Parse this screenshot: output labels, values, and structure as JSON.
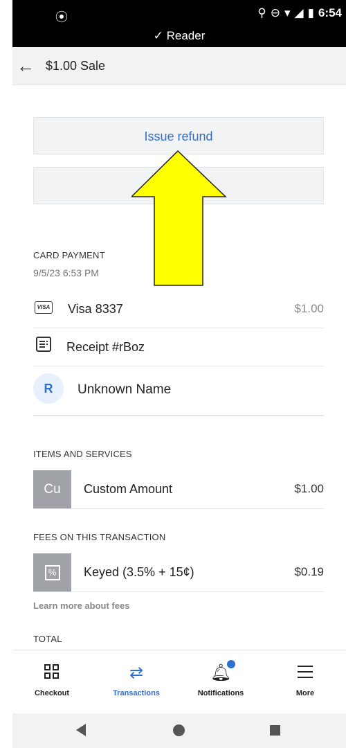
{
  "status_bar": {
    "left_icon": "screen-record-icon",
    "icons": [
      "location-icon",
      "do-not-disturb-icon",
      "wifi-icon",
      "signal-icon",
      "battery-icon"
    ],
    "time": "6:54",
    "reader_label": "✓ Reader"
  },
  "header": {
    "title": "$1.00 Sale"
  },
  "actions": {
    "refund_label": "Issue refund"
  },
  "card_payment": {
    "heading": "CARD PAYMENT",
    "datetime": "9/5/23 6:53 PM",
    "card_icon_text": "VISA",
    "card_label": "Visa 8337",
    "card_amount": "$1.00",
    "receipt_label": "Receipt #rBoz",
    "customer_icon": "R",
    "customer_name": "Unknown Name"
  },
  "items": {
    "heading": "ITEMS AND SERVICES",
    "tile_text": "Cu",
    "name": "Custom Amount",
    "amount": "$1.00"
  },
  "fees": {
    "heading": "FEES ON THIS TRANSACTION",
    "tile_text": "%",
    "name": "Keyed (3.5% + 15¢)",
    "amount": "$0.19",
    "learn_more": "Learn more about fees"
  },
  "total": {
    "heading": "TOTAL"
  },
  "bottom_nav": {
    "checkout": "Checkout",
    "transactions": "Transactions",
    "notifications": "Notifications",
    "more": "More",
    "active": "transactions",
    "accent_color": "#2f6fcf"
  },
  "annotation": {
    "arrow_color": "#ffff00"
  }
}
